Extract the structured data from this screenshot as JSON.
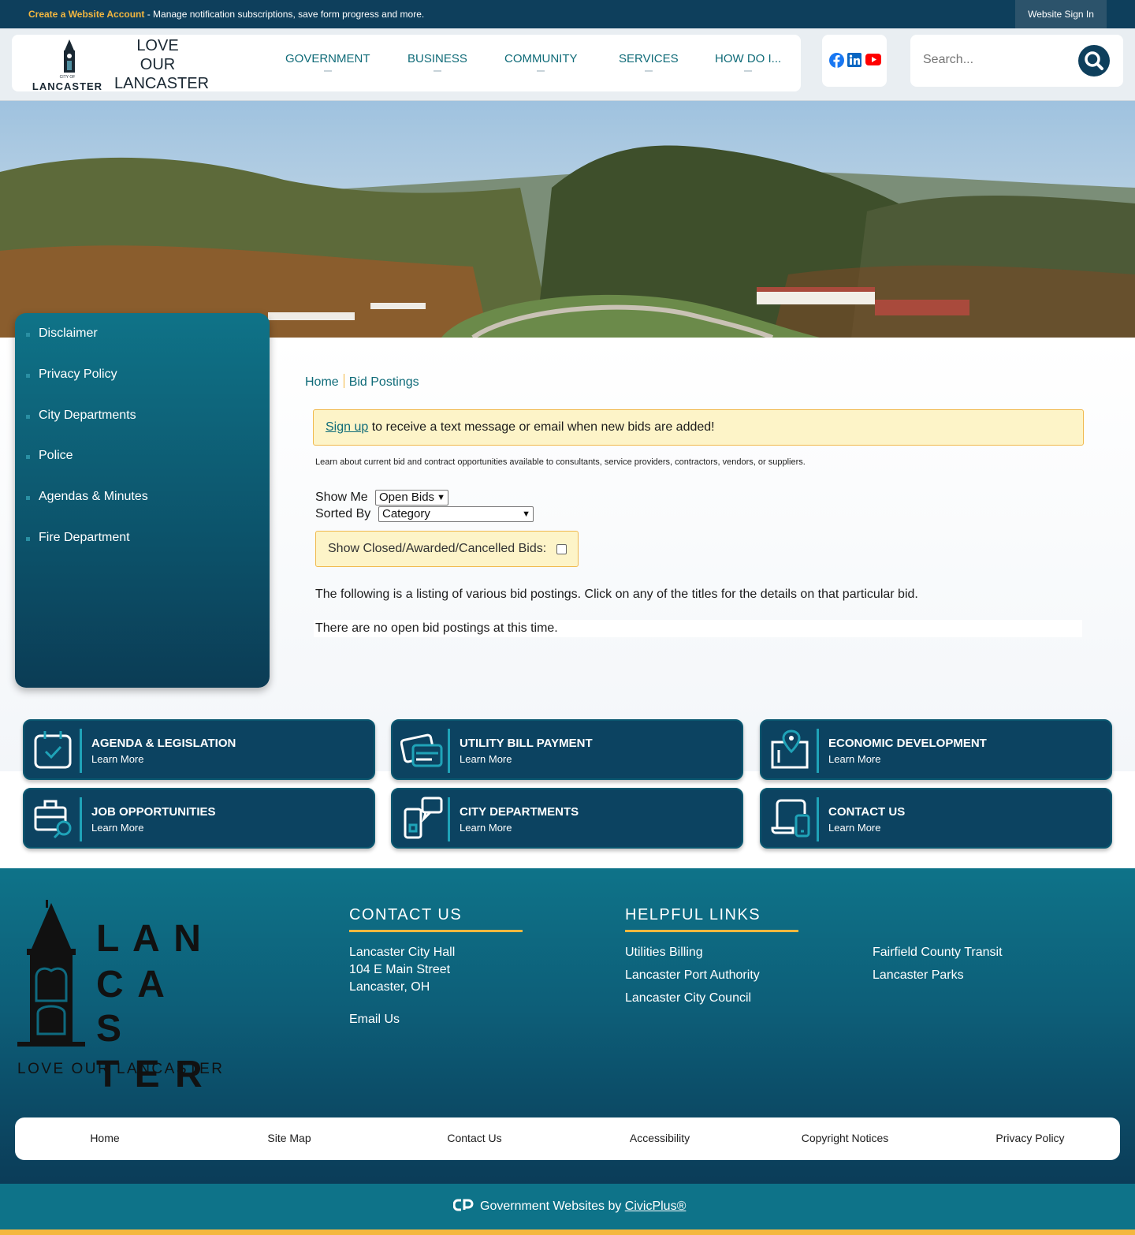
{
  "topbar": {
    "create_link": "Create a Website Account",
    "message": " - Manage notification subscriptions, save form progress and more.",
    "signin": "Website Sign In"
  },
  "logo": {
    "city_of": "CITY OF",
    "city": "LANCASTER",
    "love": "LOVE",
    "our": "OUR",
    "lancaster": "LANCASTER"
  },
  "nav": [
    "GOVERNMENT",
    "BUSINESS",
    "COMMUNITY",
    "SERVICES",
    "HOW DO I..."
  ],
  "social": [
    "facebook-icon",
    "linkedin-icon",
    "youtube-icon"
  ],
  "search": {
    "placeholder": "Search..."
  },
  "sidebar": [
    "Disclaimer",
    "Privacy Policy",
    "City Departments",
    "Police",
    "Agendas & Minutes",
    "Fire Department"
  ],
  "breadcrumb": {
    "home": "Home",
    "current": "Bid Postings"
  },
  "alert": {
    "link": "Sign up",
    "text": " to receive a text message or email when new bids are added!"
  },
  "intro": "Learn about current bid and contract opportunities available to consultants, service providers, contractors, vendors, or suppliers.",
  "filters": {
    "show_me_label": "Show Me",
    "show_me_value": "Open Bids",
    "sorted_by_label": "Sorted By",
    "sorted_by_value": "Category",
    "show_closed_label": "Show Closed/Awarded/Cancelled Bids:",
    "show_closed_checked": false
  },
  "listing_text": "The following is a listing of various bid postings. Click on any of the titles for the details on that particular bid.",
  "no_postings": "There are no open bid postings at this time.",
  "quicklinks": [
    {
      "title": "AGENDA & LEGISLATION",
      "sub": "Learn More",
      "icon": "calendar-check-icon"
    },
    {
      "title": "UTILITY BILL PAYMENT",
      "sub": "Learn More",
      "icon": "credit-card-icon"
    },
    {
      "title": "ECONOMIC DEVELOPMENT",
      "sub": "Learn More",
      "icon": "map-pin-icon"
    },
    {
      "title": "JOB OPPORTUNITIES",
      "sub": "Learn More",
      "icon": "briefcase-search-icon"
    },
    {
      "title": "CITY DEPARTMENTS",
      "sub": "Learn More",
      "icon": "phone-chat-icon"
    },
    {
      "title": "CONTACT US",
      "sub": "Learn More",
      "icon": "devices-icon"
    }
  ],
  "footer": {
    "logo_l1": "L A N",
    "logo_l2": "C A S",
    "logo_l3": "T E R",
    "logo_tag": "LOVE OUR LANCASTER",
    "contact_heading": "CONTACT US",
    "contact_l1": "Lancaster City Hall",
    "contact_l2": "104 E Main Street",
    "contact_l3": "Lancaster, OH",
    "email": "Email Us",
    "links_heading": "HELPFUL LINKS",
    "links_col1": [
      "Utilities Billing",
      "Lancaster Port Authority",
      "Lancaster City Council"
    ],
    "links_col2": [
      "Fairfield County Transit",
      "Lancaster Parks"
    ]
  },
  "bottom_nav": [
    "Home",
    "Site Map",
    "Contact Us",
    "Accessibility",
    "Copyright Notices",
    "Privacy Policy"
  ],
  "civicplus": {
    "prefix": "Government Websites by ",
    "link": "CivicPlus®"
  },
  "colors": {
    "navy": "#0e3f5c",
    "teal": "#0f7388",
    "gold": "#f4b73f",
    "alert_bg": "#fdf4c8"
  }
}
